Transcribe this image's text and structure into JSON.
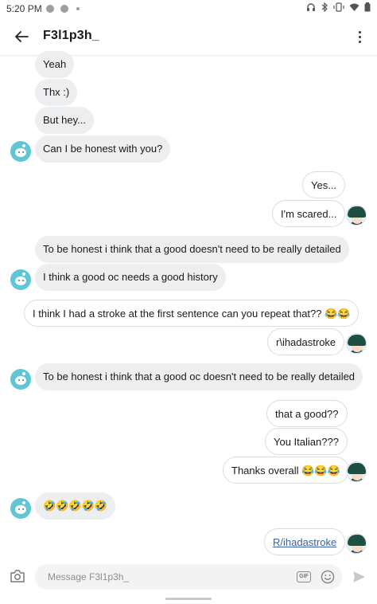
{
  "status_bar": {
    "time": "5:20 PM",
    "icons": [
      "headphones-icon",
      "bluetooth-icon",
      "vibrate-icon",
      "wifi-icon",
      "battery-icon"
    ]
  },
  "header": {
    "title": "F3l1p3h_",
    "back_icon": "arrow-left-icon",
    "menu_icon": "more-vertical-icon"
  },
  "messages": [
    {
      "side": "in",
      "text": "Yeah"
    },
    {
      "side": "in",
      "text": "Thx :)"
    },
    {
      "side": "in",
      "text": "But hey..."
    },
    {
      "side": "in",
      "text": "Can I be honest with you?"
    },
    {
      "side": "out",
      "text": "Yes..."
    },
    {
      "side": "out",
      "text": "I'm scared..."
    },
    {
      "side": "in",
      "text": "To be honest i think that a good doesn't need to be really detailed"
    },
    {
      "side": "in",
      "text": "I think a good oc needs a good history"
    },
    {
      "side": "out",
      "text": "I think I had a stroke at the first sentence can you repeat that?? 😂😂"
    },
    {
      "side": "out",
      "text": "r\\ihadastroke"
    },
    {
      "side": "in",
      "text": "To be honest i think that a good oc doesn't need to be really detailed"
    },
    {
      "side": "out",
      "text": "that a good??"
    },
    {
      "side": "out",
      "text": "You Italian???"
    },
    {
      "side": "out",
      "text": "Thanks overall 😂😂😂"
    },
    {
      "side": "in",
      "text": "🤣🤣🤣🤣🤣"
    },
    {
      "side": "out",
      "text": "R/ihadastroke",
      "link": true
    }
  ],
  "composer": {
    "placeholder": "Message F3l1p3h_",
    "gif_label": "GIF",
    "camera_icon": "camera-icon",
    "emoji_icon": "smiley-icon",
    "send_icon": "send-icon"
  }
}
